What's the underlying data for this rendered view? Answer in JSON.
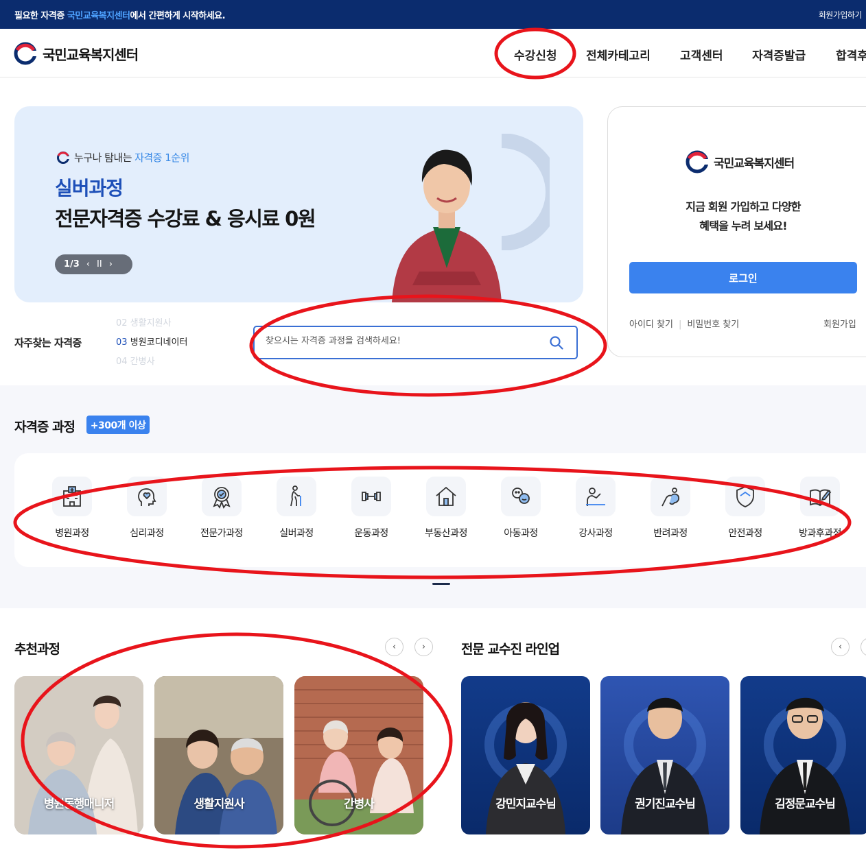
{
  "topbar": {
    "msg_pre": "필요한 자격증 ",
    "msg_highlight": "국민교육복지센터",
    "msg_post": "에서 간편하게 시작하세요.",
    "join": "회원가입하기"
  },
  "header": {
    "logo": "국민교육복지센터",
    "nav": [
      "수강신청",
      "전체카테고리",
      "고객센터",
      "자격증발급",
      "합격후"
    ]
  },
  "hero": {
    "tag_pre": "누구나 탐내는",
    "tag_highlight": "자격증 1순위",
    "title1": "실버과정",
    "title2": "전문자격증 수강료 & 응시료 0원",
    "pager": "1/3",
    "prev": "‹",
    "pause": "II",
    "next": "›"
  },
  "login": {
    "brand": "국민교육복지센터",
    "msg1": "지금 회원 가입하고 다양한",
    "msg2": "혜택을 누려 보세요!",
    "button": "로그인",
    "find_id": "아이디 찾기",
    "find_pw": "비밀번호 찾기",
    "signup": "회원가입"
  },
  "frequent": {
    "label": "자주찾는 자격증",
    "prev_item": "02 생활지원사",
    "current_num": "03",
    "current_name": "병원코디네이터",
    "next_item": "04 간병사"
  },
  "search": {
    "placeholder": "찾으시는 자격증 과정을 검색하세요!"
  },
  "cert": {
    "title": "자격증 과정",
    "badge": "+300개 이상",
    "categories": [
      "병원과정",
      "심리과정",
      "전문가과정",
      "실버과정",
      "운동과정",
      "부동산과정",
      "아동과정",
      "강사과정",
      "반려과정",
      "안전과정",
      "방과후과정"
    ]
  },
  "recommend": {
    "title": "추천과정",
    "prev": "‹",
    "next": "›",
    "cards": [
      "병원동행매니저",
      "생활지원사",
      "간병사"
    ]
  },
  "professors": {
    "title": "전문 교수진 라인업",
    "prev": "‹",
    "cards": [
      "강민지교수님",
      "권기진교수님",
      "김정문교수님"
    ]
  },
  "colors": {
    "topbar": "#0b2c6e",
    "accent": "#3a82ee",
    "annotation": "#e8141b"
  }
}
